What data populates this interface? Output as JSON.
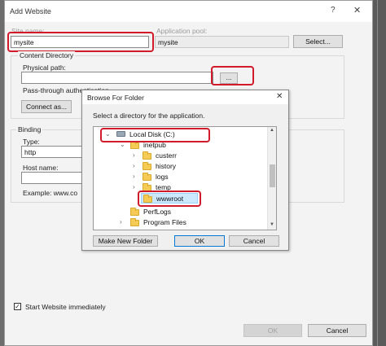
{
  "dialog": {
    "title": "Add Website",
    "help": "?",
    "close": "✕"
  },
  "site": {
    "site_name_label": "Site name:",
    "site_name_value": "mysite",
    "app_pool_label": "Application pool:",
    "app_pool_value": "mysite",
    "select_button": "Select..."
  },
  "content_directory": {
    "group_label": "Content Directory",
    "physical_path_label": "Physical path:",
    "physical_path_value": "",
    "browse_button": "...",
    "pass_through_label": "Pass-through authentication",
    "connect_as_button": "Connect as..."
  },
  "binding": {
    "group_label": "Binding",
    "type_label": "Type:",
    "type_value": "http",
    "host_name_label": "Host name:",
    "example_label": "Example: www.co"
  },
  "start_website": {
    "checked": true,
    "label": "Start Website immediately"
  },
  "footer": {
    "ok_button": "OK",
    "cancel_button": "Cancel"
  },
  "browse_folder": {
    "title": "Browse For Folder",
    "close": "✕",
    "instruction": "Select a directory for the application.",
    "tree": [
      {
        "label": "Local Disk (C:)",
        "icon": "drive-icon",
        "expanded": true
      },
      {
        "label": "inetpub",
        "icon": "folder-icon",
        "expanded": true
      },
      {
        "label": "custerr",
        "icon": "folder-icon",
        "expanded": false
      },
      {
        "label": "history",
        "icon": "folder-icon",
        "expanded": false
      },
      {
        "label": "logs",
        "icon": "folder-icon",
        "expanded": false
      },
      {
        "label": "temp",
        "icon": "folder-icon",
        "expanded": false
      },
      {
        "label": "wwwroot",
        "icon": "folder-icon",
        "selected": true
      },
      {
        "label": "PerfLogs",
        "icon": "folder-icon"
      },
      {
        "label": "Program Files",
        "icon": "folder-icon",
        "expanded": false
      }
    ],
    "make_new_folder_button": "Make New Folder",
    "ok_button": "OK",
    "cancel_button": "Cancel"
  },
  "colors": {
    "highlight_red": "#d11a2a",
    "selection_blue": "#cce8ff",
    "folder_yellow": "#f5cb55"
  }
}
